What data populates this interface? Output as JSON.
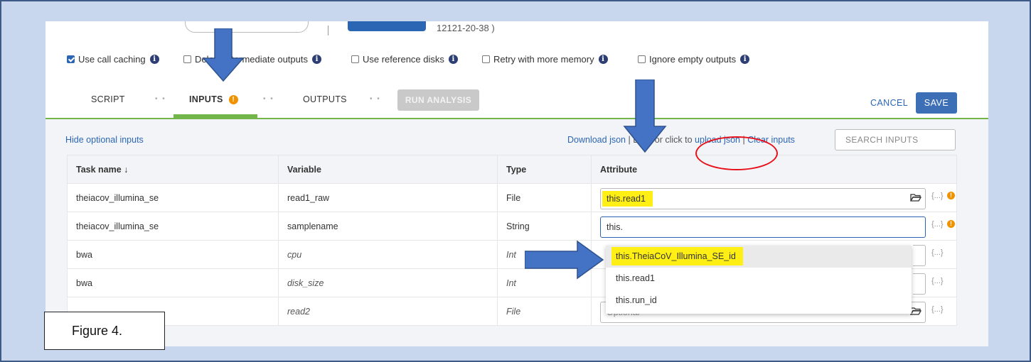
{
  "header": {
    "workflow_id_partial": "12121-20-38 )"
  },
  "options": [
    {
      "label": "Use call caching",
      "checked": true
    },
    {
      "label": "Delete intermediate outputs",
      "checked": false
    },
    {
      "label": "Use reference disks",
      "checked": false
    },
    {
      "label": "Retry with more memory",
      "checked": false
    },
    {
      "label": "Ignore empty outputs",
      "checked": false
    }
  ],
  "info_icon_glyph": "i",
  "tabs": {
    "script": "SCRIPT",
    "inputs": "INPUTS",
    "inputs_badge": "!",
    "outputs": "OUTPUTS",
    "run_analysis": "RUN ANALYSIS",
    "separator": "• •"
  },
  "actions": {
    "cancel": "CANCEL",
    "save": "SAVE"
  },
  "inputs_toolbar": {
    "hide_optional": "Hide optional inputs",
    "download_json": "Download json",
    "drag_text": "| Drag or click to",
    "upload_json": "upload json",
    "pipe": "|",
    "clear_inputs": "Clear inputs",
    "search_placeholder": "SEARCH INPUTS"
  },
  "table": {
    "headers": {
      "task_name": "Task name ↓",
      "variable": "Variable",
      "type": "Type",
      "attribute": "Attribute"
    },
    "rows": [
      {
        "task": "theiacov_illumina_se",
        "variable": "read1_raw",
        "type": "File",
        "attribute": "this.read1",
        "optional": false
      },
      {
        "task": "theiacov_illumina_se",
        "variable": "samplename",
        "type": "String",
        "attribute": "this.",
        "optional": false
      },
      {
        "task": "bwa",
        "variable": "cpu",
        "type": "Int",
        "attribute": "",
        "optional": true
      },
      {
        "task": "bwa",
        "variable": "disk_size",
        "type": "Int",
        "attribute": "",
        "optional": true
      },
      {
        "task": "",
        "variable": "read2",
        "type": "File",
        "attribute": "",
        "placeholder": "Optional",
        "optional": true
      }
    ],
    "braces": "{...}",
    "warn": "!"
  },
  "autocomplete": [
    "this.TheiaCoV_Illumina_SE_id",
    "this.read1",
    "this.run_id"
  ],
  "annotation": {
    "figure_label": "Figure 4."
  },
  "colors": {
    "accent": "#2b66b5",
    "green": "#72b54b",
    "warning": "#f29100",
    "highlight": "#ffef15",
    "callout_red": "#e8101a",
    "arrow_blue": "#4472c4"
  }
}
